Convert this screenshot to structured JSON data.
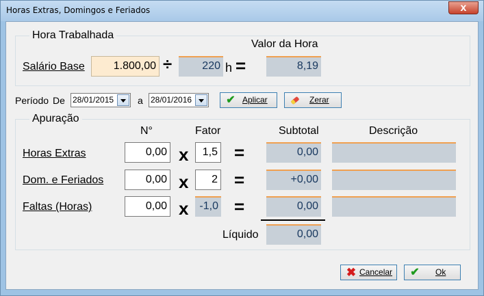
{
  "window": {
    "title": "Horas Extras, Domingos e Feriados",
    "close_label": "x"
  },
  "hora_trabalhada": {
    "legend": "Hora Trabalhada",
    "valor_da_hora_label": "Valor da Hora",
    "salario_base_label": "Salário Base",
    "salario_base_value": "1.800,00",
    "divide_symbol": "÷",
    "horas_value": "220",
    "horas_unit": "h",
    "equals_symbol": "=",
    "valor_da_hora_value": "8,19"
  },
  "periodo": {
    "label": "Período",
    "de_label": "De",
    "de_value": "28/01/2015",
    "a_label": "a",
    "a_value": "28/01/2016",
    "aplicar_label": "Aplicar",
    "zerar_label": "Zerar"
  },
  "apuracao": {
    "legend": "Apuração",
    "columns": {
      "numero": "N°",
      "fator": "Fator",
      "subtotal": "Subtotal",
      "descricao": "Descrição"
    },
    "times_symbol": "x",
    "equals_symbol": "=",
    "rows": [
      {
        "label": "Horas Extras",
        "numero": "0,00",
        "fator": "1,5",
        "subtotal": "0,00",
        "descricao": ""
      },
      {
        "label": "Dom. e Feriados",
        "numero": "0,00",
        "fator": "2",
        "subtotal": "+0,00",
        "descricao": ""
      },
      {
        "label": "Faltas (Horas)",
        "numero": "0,00",
        "fator": "-1,0",
        "subtotal": "0,00",
        "descricao": ""
      }
    ],
    "liquido_label": "Líquido",
    "liquido_value": "0,00"
  },
  "footer": {
    "cancelar_label": "Cancelar",
    "ok_label": "Ok"
  },
  "colors": {
    "accent_orange": "#f0a050",
    "readonly_bg": "#c8d0d8",
    "input_yellow": "#fdebd0",
    "check_green": "#1e9a1e",
    "cancel_red": "#d41c1c"
  },
  "icons": {
    "aplicar": "check-icon",
    "zerar": "eraser-icon",
    "cancelar": "x-mark-icon",
    "ok": "check-icon"
  }
}
